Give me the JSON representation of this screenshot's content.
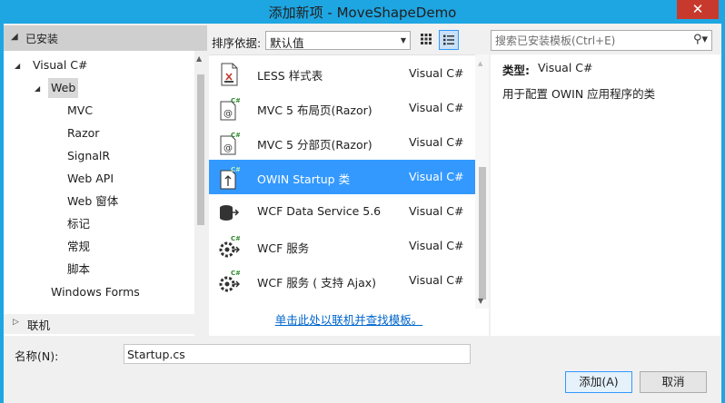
{
  "window": {
    "title": "添加新项 - MoveShapeDemo",
    "close_glyph": "✕"
  },
  "left": {
    "installed_label": "已安装",
    "tree": [
      {
        "label": "Visual C#",
        "level": 1,
        "expanded": true
      },
      {
        "label": "Web",
        "level": 2,
        "expanded": true,
        "selected": true
      },
      {
        "label": "MVC",
        "level": 3
      },
      {
        "label": "Razor",
        "level": 3
      },
      {
        "label": "SignalR",
        "level": 3
      },
      {
        "label": "Web API",
        "level": 3
      },
      {
        "label": "Web 窗体",
        "level": 3
      },
      {
        "label": "标记",
        "level": 3
      },
      {
        "label": "常规",
        "level": 3
      },
      {
        "label": "脚本",
        "level": 3
      },
      {
        "label": "Windows Forms",
        "level": 2
      }
    ],
    "online_label": "联机"
  },
  "sort": {
    "label": "排序依据:",
    "value": "默认值"
  },
  "templates": [
    {
      "name": "LESS 样式表",
      "lang": "Visual C#",
      "icon": "less-file-icon"
    },
    {
      "name": "MVC 5 布局页(Razor)",
      "lang": "Visual C#",
      "icon": "razor-layout-icon"
    },
    {
      "name": "MVC 5 分部页(Razor)",
      "lang": "Visual C#",
      "icon": "razor-partial-icon"
    },
    {
      "name": "OWIN Startup 类",
      "lang": "Visual C#",
      "icon": "owin-startup-icon",
      "selected": true
    },
    {
      "name": "WCF Data Service 5.6",
      "lang": "Visual C#",
      "icon": "wcf-data-service-icon"
    },
    {
      "name": "WCF 服务",
      "lang": "Visual C#",
      "icon": "wcf-service-icon"
    },
    {
      "name": "WCF 服务 ( 支持 Ajax)",
      "lang": "Visual C#",
      "icon": "wcf-ajax-service-icon"
    }
  ],
  "online_link": "单击此处以联机并查找模板。",
  "search": {
    "placeholder": "搜索已安装模板(Ctrl+E)"
  },
  "detail": {
    "type_label": "类型:",
    "type_value": "Visual C#",
    "description": "用于配置 OWIN 应用程序的类"
  },
  "name_field": {
    "label": "名称(N):",
    "value": "Startup.cs"
  },
  "buttons": {
    "add": "添加(A)",
    "cancel": "取消"
  },
  "colors": {
    "title_bar": "#1ea6e2",
    "selection": "#3399ff",
    "link": "#0066cc",
    "close": "#c7392d"
  }
}
